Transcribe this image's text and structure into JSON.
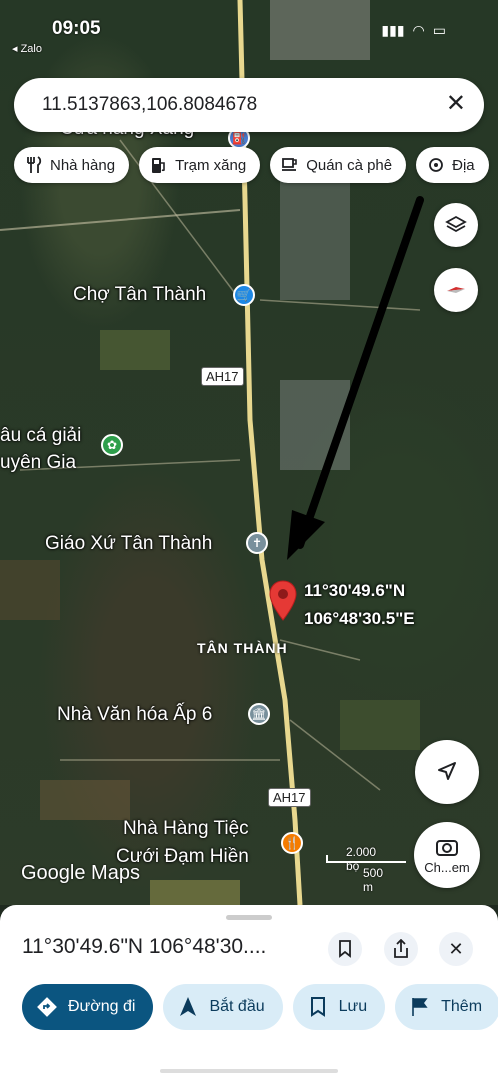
{
  "status_bar": {
    "time": "09:05",
    "back_app": "◂ Zalo"
  },
  "search": {
    "query": "11.5137863,106.8084678",
    "clear_icon": "close-icon"
  },
  "chips": [
    {
      "label": "Nhà hàng",
      "icon": "restaurant-icon"
    },
    {
      "label": "Trạm xăng",
      "icon": "gas-station-icon"
    },
    {
      "label": "Quán cà phê",
      "icon": "coffee-icon"
    },
    {
      "label": "Địa",
      "icon": "attractions-icon"
    }
  ],
  "map": {
    "places": {
      "gas_station_partial": "Cửa hàng Xăng",
      "market": "Chợ Tân Thành",
      "fishing": "âu cá giải",
      "fishing2": "uyên Gia",
      "church": "Giáo Xứ Tân Thành",
      "culture_house": "Nhà Văn hóa Ấp 6",
      "wedding1": "Nhà Hàng Tiệc",
      "wedding2": "Cưới Đạm Hiền"
    },
    "area_label": "TÂN THÀNH",
    "road_labels": [
      "AH17",
      "AH17"
    ],
    "pin_coords": {
      "lat": "11°30'49.6\"N",
      "lng": "106°48'30.5\"E"
    },
    "watermark": "Google Maps",
    "scale": {
      "top": "2.000 bộ",
      "bottom": "500 m"
    },
    "streetview_label": "Ch...em"
  },
  "sheet": {
    "title": "11°30'49.6\"N 106°48'30....",
    "actions": [
      {
        "label": "Đường đi",
        "icon": "directions-icon"
      },
      {
        "label": "Bắt đầu",
        "icon": "navigation-icon"
      },
      {
        "label": "Lưu",
        "icon": "bookmark-icon"
      },
      {
        "label": "Thêm",
        "icon": "flag-icon"
      }
    ]
  },
  "colors": {
    "primary": "#0b5580",
    "pin": "#e53935",
    "chip_bg": "#ffffff",
    "action_bg": "#d9ecf7"
  }
}
